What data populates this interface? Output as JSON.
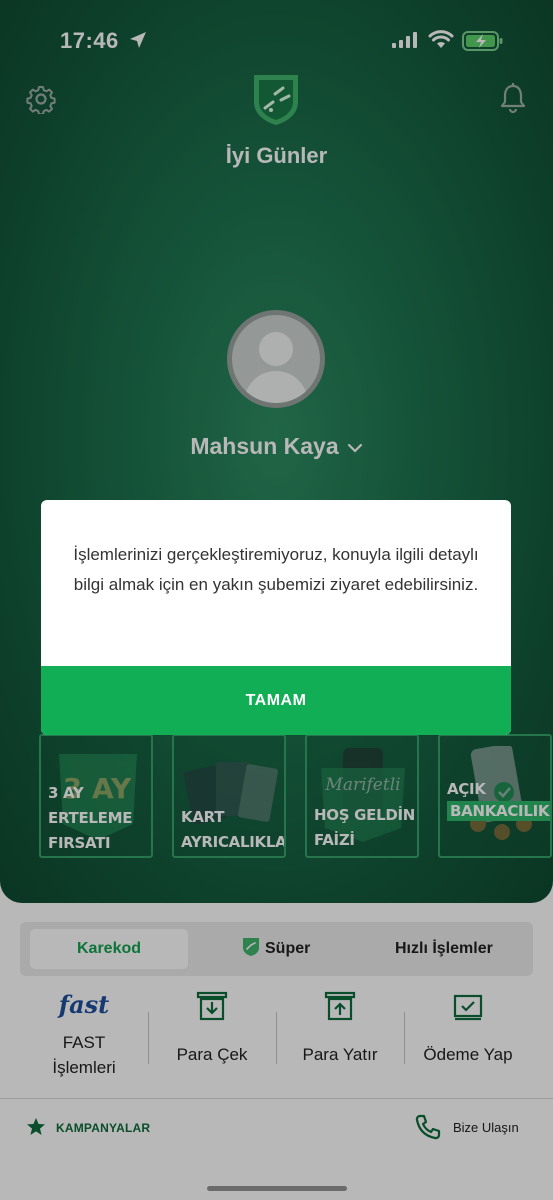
{
  "status_bar": {
    "time": "17:46"
  },
  "header": {
    "greeting": "İyi Günler"
  },
  "profile": {
    "name": "Mahsun Kaya"
  },
  "promos": [
    {
      "line1": "3 AY",
      "line2": "ERTELEME",
      "line3": "FIRSATI",
      "art": "3 AY"
    },
    {
      "line1": "KART",
      "line2": "AYRICALIKLARI",
      "line3": "",
      "art": ""
    },
    {
      "line1": "HOŞ GELDİN",
      "line2": "FAİZİ",
      "line3": "",
      "art": "Marifetli"
    },
    {
      "line1": "AÇIK",
      "line2": "BANKACILIK",
      "line3": "",
      "art": ""
    }
  ],
  "tabs": {
    "karekod": "Karekod",
    "super": "Süper",
    "hizli": "Hızlı İşlemler"
  },
  "quick_actions": {
    "fast_logo": "fast",
    "fast_line1": "FAST",
    "fast_line2": "İşlemleri",
    "withdraw": "Para Çek",
    "deposit": "Para Yatır",
    "pay": "Ödeme Yap"
  },
  "footer": {
    "campaigns": "KAMPANYALAR",
    "contact": "Bize Ulaşın"
  },
  "modal": {
    "message": "İşlemlerinizi gerçekleştiremiyoruz, konuyla ilgili detaylı bilgi almak için en yakın şubemizi ziyaret edebilirsiniz.",
    "button": "TAMAM"
  },
  "colors": {
    "brand_green": "#12ae56",
    "hero_green": "#1e7450",
    "dark_green": "#0d6b3b"
  }
}
